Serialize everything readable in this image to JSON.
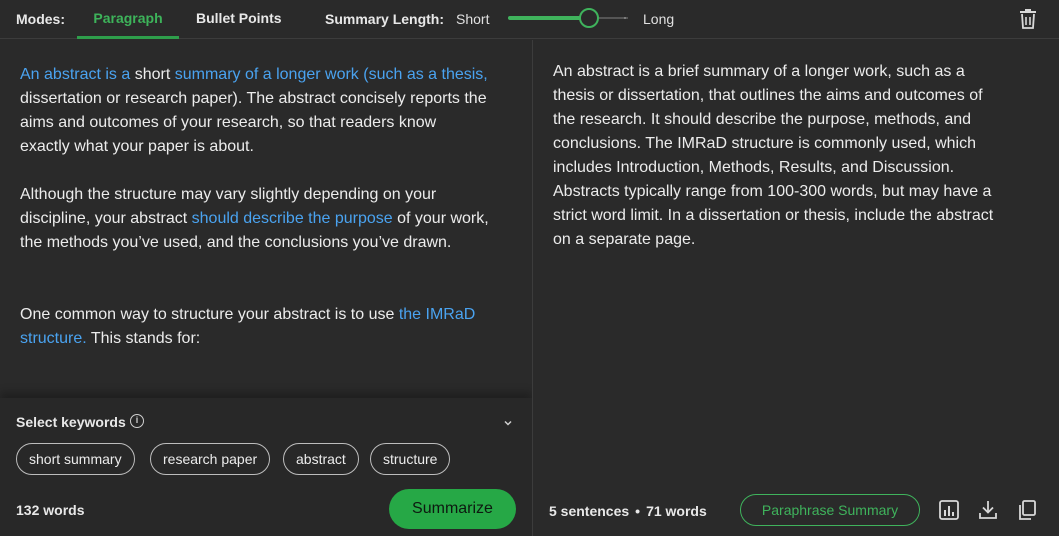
{
  "topbar": {
    "modes_label": "Modes:",
    "tabs": [
      {
        "label": "Paragraph",
        "active": true
      },
      {
        "label": "Bullet Points",
        "active": false
      }
    ],
    "summary_length_label": "Summary Length:",
    "short_label": "Short",
    "long_label": "Long",
    "slider_level": 0.66,
    "delete_icon": "trash-icon"
  },
  "input": {
    "p1": [
      {
        "text": "An abstract is a ",
        "hl": true
      },
      {
        "text": "short ",
        "hl": false
      },
      {
        "text": "summary of a longer work (such as a thesis, ",
        "hl": true
      },
      {
        "text": " dissertation or research paper). The abstract concisely reports the aims and outcomes of your research, so that readers know exactly what your paper is about.",
        "hl": false
      }
    ],
    "p2": [
      {
        "text": "Although the structure may vary slightly depending on your discipline, your abstract ",
        "hl": false
      },
      {
        "text": "should describe the purpose",
        "hl": true
      },
      {
        "text": " of your work, the methods you’ve used, and the conclusions you’ve drawn.",
        "hl": false
      }
    ],
    "p3": [
      {
        "text": "One common way to structure your abstract is to use ",
        "hl": false
      },
      {
        "text": "the IMRaD structure.",
        "hl": true
      },
      {
        "text": " This stands for:",
        "hl": false
      }
    ]
  },
  "keywords": {
    "title": "Select keywords",
    "info_icon": "info-icon",
    "chips": [
      "short summary",
      "research paper",
      "abstract",
      "structure"
    ]
  },
  "left_footer": {
    "word_count": "132 words",
    "summarize_label": "Summarize"
  },
  "output": {
    "text": "An abstract is a brief summary of a longer work, such as a thesis or dissertation, that outlines the aims and outcomes of the research. It should describe the purpose, methods, and conclusions. The IMRaD structure is commonly used, which includes Introduction, Methods, Results, and Discussion. Abstracts typically range from 100-300 words, but may have a strict word limit. In a dissertation or thesis, include the abstract on a separate page.",
    "sentences": "5 sentences",
    "separator": "•",
    "words": "71 words",
    "paraphrase_label": "Paraphrase Summary"
  },
  "colors": {
    "accent": "#3fb35c",
    "button": "#26a846",
    "highlight": "#4aa3f0",
    "background": "#2a2a2a"
  }
}
